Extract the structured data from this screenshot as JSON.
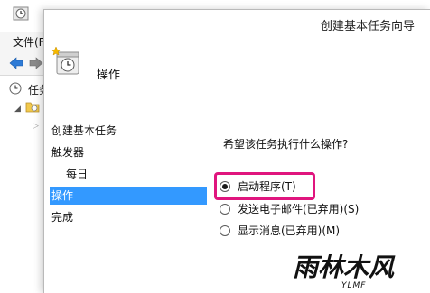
{
  "main_window": {
    "menu_file": "文件(F)",
    "tree_item_1": "任务",
    "icons": [
      "task-scheduler-icon",
      "back-arrow-icon",
      "forward-arrow-icon",
      "clock-icon",
      "folder-icon"
    ]
  },
  "dialog": {
    "title": "创建基本任务向导",
    "header_title": "操作",
    "steps": [
      {
        "label": "创建基本任务",
        "active": false
      },
      {
        "label": "触发器",
        "active": false
      },
      {
        "label": "每日",
        "active": false,
        "sub": true
      },
      {
        "label": "操作",
        "active": true
      },
      {
        "label": "完成",
        "active": false
      }
    ],
    "question": "希望该任务执行什么操作?",
    "options": [
      {
        "label": "启动程序(T)",
        "checked": true
      },
      {
        "label": "发送电子邮件(已弃用)(S)",
        "checked": false
      },
      {
        "label": "显示消息(已弃用)(M)",
        "checked": false
      }
    ],
    "highlight_color": "#e0157e",
    "accent_color": "#3399ff"
  },
  "watermark": {
    "main": "雨林木风",
    "sub": "YLMF"
  }
}
